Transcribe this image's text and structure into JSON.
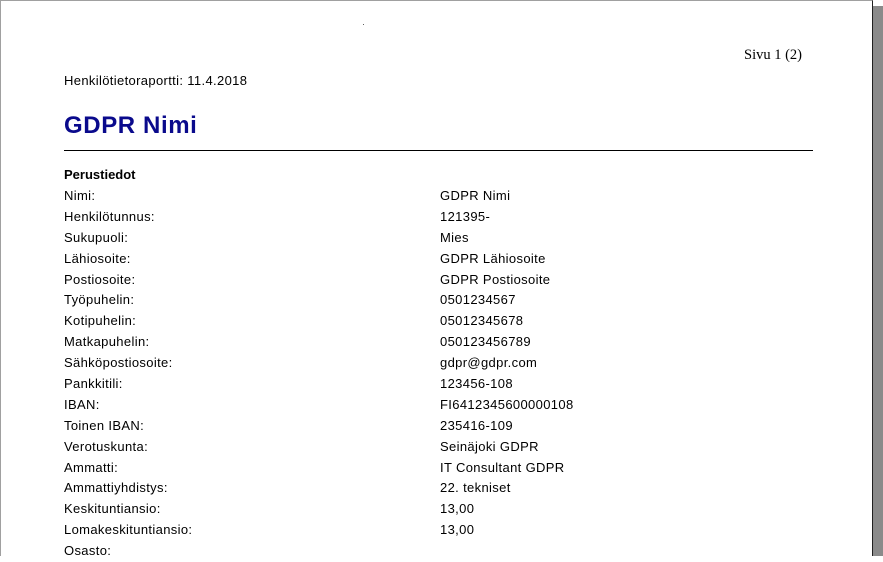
{
  "header": {
    "page_number": "Sivu 1 (2)",
    "report_title": "Henkilötietoraportti: 11.4.2018"
  },
  "person": {
    "name": "GDPR Nimi"
  },
  "basic_info": {
    "title": "Perustiedot",
    "fields": [
      {
        "label": "Nimi:",
        "value": "GDPR Nimi"
      },
      {
        "label": "Henkilötunnus:",
        "value": "121395-"
      },
      {
        "label": "Sukupuoli:",
        "value": "Mies"
      },
      {
        "label": "Lähiosoite:",
        "value": "GDPR Lähiosoite"
      },
      {
        "label": "Postiosoite:",
        "value": "GDPR Postiosoite"
      },
      {
        "label": "Työpuhelin:",
        "value": "0501234567"
      },
      {
        "label": "Kotipuhelin:",
        "value": "05012345678"
      },
      {
        "label": "Matkapuhelin:",
        "value": "050123456789"
      },
      {
        "label": "Sähköpostiosoite:",
        "value": "gdpr@gdpr.com"
      },
      {
        "label": "Pankkitili:",
        "value": "123456-108"
      },
      {
        "label": "IBAN:",
        "value": "FI6412345600000108"
      },
      {
        "label": "Toinen IBAN:",
        "value": "235416-109"
      },
      {
        "label": "Verotuskunta:",
        "value": "Seinäjoki GDPR"
      },
      {
        "label": "Ammatti:",
        "value": "IT Consultant GDPR"
      },
      {
        "label": "Ammattiyhdistys:",
        "value": "22. tekniset"
      },
      {
        "label": "Keskituntiansio:",
        "value": "13,00"
      },
      {
        "label": "Lomakeskituntiansio:",
        "value": "13,00"
      },
      {
        "label": "Osasto:",
        "value": ""
      }
    ]
  }
}
